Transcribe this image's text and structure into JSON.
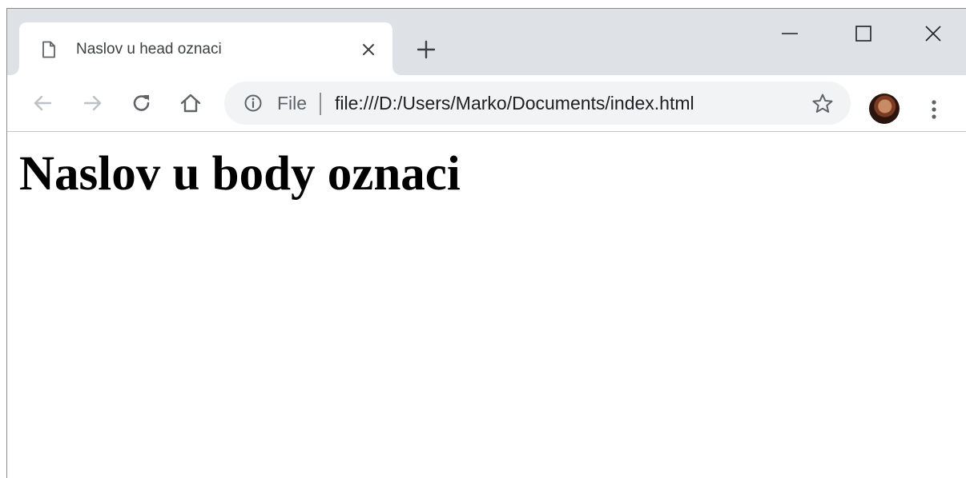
{
  "tab": {
    "title": "Naslov u head oznaci"
  },
  "address_bar": {
    "scheme_label": "File",
    "separator": "|",
    "url": "file:///D:/Users/Marko/Documents/index.html"
  },
  "icons": {
    "tab_favicon": "page-icon",
    "tab_close": "close-icon",
    "new_tab": "plus-icon",
    "minimize": "minimize-icon",
    "maximize": "maximize-icon",
    "close_window": "close-icon",
    "back": "arrow-left-icon",
    "forward": "arrow-right-icon",
    "reload": "reload-icon",
    "home": "home-icon",
    "site_info": "info-icon",
    "bookmark": "star-icon",
    "profile": "avatar",
    "menu": "kebab-menu-icon"
  },
  "colors": {
    "titlebar": "#dee1e6",
    "omnibox": "#f1f3f4",
    "disabled_icon": "#bdc1c6",
    "active_icon": "#5f6368"
  },
  "page": {
    "heading": "Naslov u body oznaci"
  }
}
